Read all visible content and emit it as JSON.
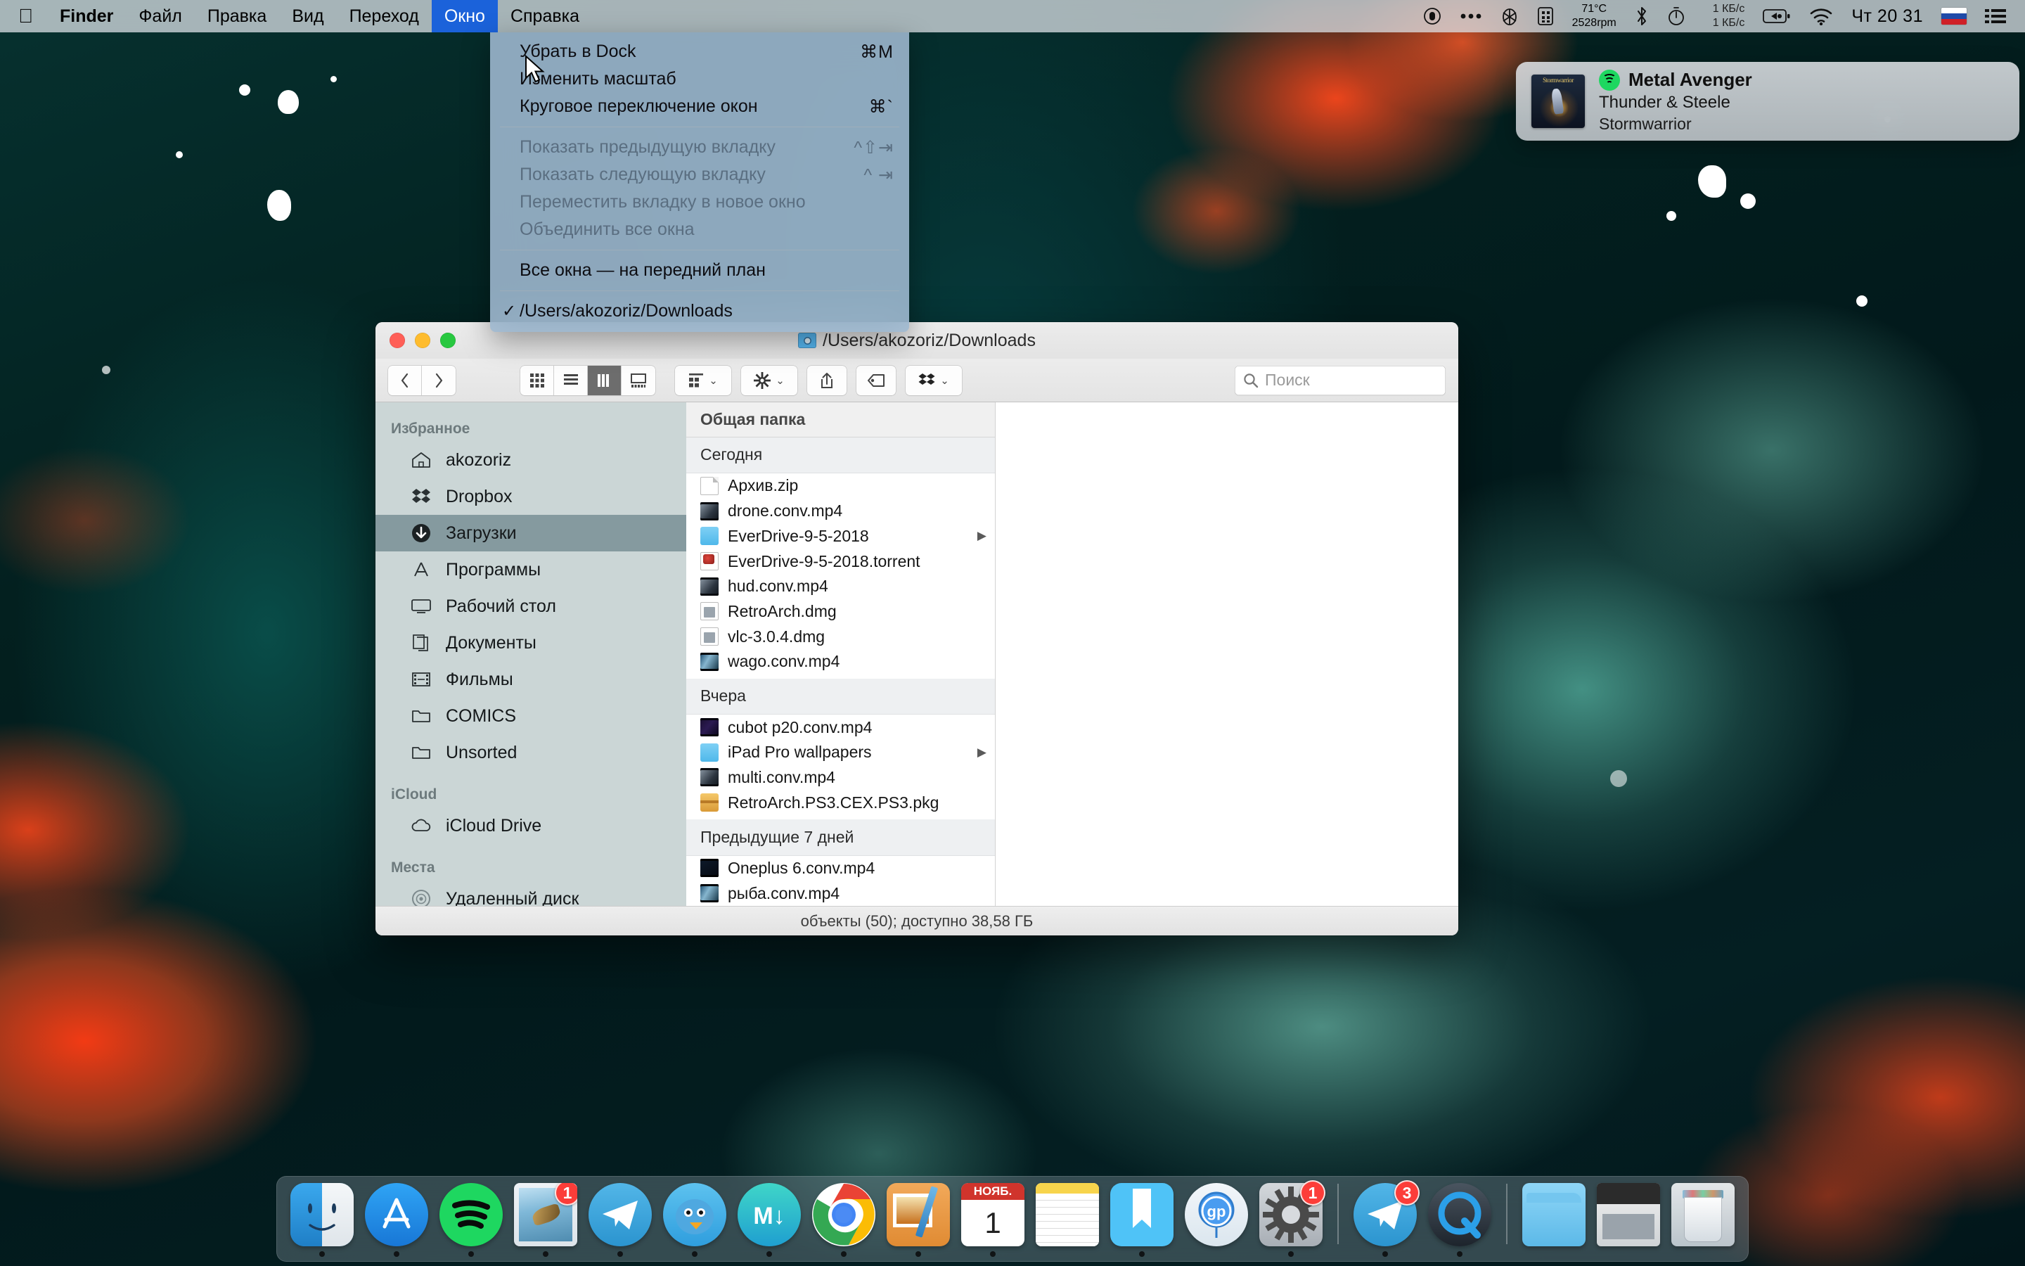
{
  "menubar": {
    "apple_icon": "apple-logo-icon",
    "items": [
      {
        "label": "Finder",
        "bold": true,
        "active": false
      },
      {
        "label": "Файл",
        "bold": false,
        "active": false
      },
      {
        "label": "Правка",
        "bold": false,
        "active": false
      },
      {
        "label": "Вид",
        "bold": false,
        "active": false
      },
      {
        "label": "Переход",
        "bold": false,
        "active": false
      },
      {
        "label": "Окно",
        "bold": false,
        "active": true
      },
      {
        "label": "Справка",
        "bold": false,
        "active": false
      }
    ],
    "status": {
      "record_icon": "record-circle-icon",
      "dots_icon": "three-dots-icon",
      "bartender_icon": "bartender-icon",
      "memory_icon": "memory-module-icon",
      "temperature": "71°C",
      "fan_rpm": "2528rpm",
      "bluetooth_icon": "bluetooth-icon",
      "timer_icon": "stopwatch-icon",
      "net_down": "1 КБ/с",
      "net_up": "1 КБ/с",
      "battery_icon": "battery-charging-icon",
      "wifi_icon": "wifi-icon",
      "clock": "Чт 20 31",
      "flag": "russian-flag-icon",
      "list_icon": "notification-center-icon"
    }
  },
  "window_menu": {
    "groups": [
      {
        "items": [
          {
            "label": "Убрать в Dock",
            "shortcut": "⌘M",
            "disabled": false,
            "checked": false
          },
          {
            "label": "Изменить масштаб",
            "shortcut": "",
            "disabled": false,
            "checked": false
          },
          {
            "label": "Круговое переключение окон",
            "shortcut": "⌘`",
            "disabled": false,
            "checked": false
          }
        ]
      },
      {
        "items": [
          {
            "label": "Показать предыдущую вкладку",
            "shortcut": "^⇧⇥",
            "disabled": true,
            "checked": false
          },
          {
            "label": "Показать следующую вкладку",
            "shortcut": "^ ⇥",
            "disabled": true,
            "checked": false
          },
          {
            "label": "Переместить вкладку в новое окно",
            "shortcut": "",
            "disabled": true,
            "checked": false
          },
          {
            "label": "Объединить все окна",
            "shortcut": "",
            "disabled": true,
            "checked": false
          }
        ]
      },
      {
        "items": [
          {
            "label": "Все окна — на передний план",
            "shortcut": "",
            "disabled": false,
            "checked": false
          }
        ]
      },
      {
        "items": [
          {
            "label": "/Users/akozoriz/Downloads",
            "shortcut": "",
            "disabled": false,
            "checked": true
          }
        ]
      }
    ],
    "check_glyph": "✓"
  },
  "notification": {
    "app": "Metal Avenger",
    "title": "Thunder & Steele",
    "subtitle": "Stormwarrior",
    "app_icon": "spotify-icon",
    "artwork_title": "Stormwarrior",
    "artwork_icon": "album-art-icon"
  },
  "finder": {
    "title_path": "/Users/akozoriz/Downloads",
    "proxy_icon": "folder-proxy-icon",
    "traffic": {
      "close": "close-button",
      "minimize": "minimize-button",
      "zoom": "zoom-button"
    },
    "nav": {
      "back": "back-button",
      "forward": "forward-button"
    },
    "view_modes": [
      {
        "name": "icon-view",
        "selected": false
      },
      {
        "name": "list-view",
        "selected": false
      },
      {
        "name": "column-view",
        "selected": true
      },
      {
        "name": "gallery-view",
        "selected": false
      }
    ],
    "toolbar_buttons": [
      {
        "name": "arrange-by-button",
        "icon": "grid-icon",
        "has_chevron": true
      },
      {
        "name": "action-button",
        "icon": "gear-icon",
        "has_chevron": true
      },
      {
        "name": "share-button",
        "icon": "share-icon",
        "has_chevron": false
      },
      {
        "name": "tags-button",
        "icon": "tag-icon",
        "has_chevron": false
      },
      {
        "name": "dropbox-button",
        "icon": "dropbox-icon",
        "has_chevron": true
      }
    ],
    "search_placeholder": "Поиск",
    "search_value": "",
    "sidebar": [
      {
        "header": "Избранное",
        "items": [
          {
            "label": "akozoriz",
            "icon": "home-icon",
            "selected": false
          },
          {
            "label": "Dropbox",
            "icon": "dropbox-icon",
            "selected": false
          },
          {
            "label": "Загрузки",
            "icon": "downloads-icon",
            "selected": true
          },
          {
            "label": "Программы",
            "icon": "applications-icon",
            "selected": false
          },
          {
            "label": "Рабочий стол",
            "icon": "desktop-icon",
            "selected": false
          },
          {
            "label": "Документы",
            "icon": "documents-icon",
            "selected": false
          },
          {
            "label": "Фильмы",
            "icon": "movies-icon",
            "selected": false
          },
          {
            "label": "COMICS",
            "icon": "folder-icon",
            "selected": false
          },
          {
            "label": "Unsorted",
            "icon": "folder-icon",
            "selected": false
          }
        ]
      },
      {
        "header": "iCloud",
        "items": [
          {
            "label": "iCloud Drive",
            "icon": "cloud-icon",
            "selected": false
          }
        ]
      },
      {
        "header": "Места",
        "items": [
          {
            "label": "Удаленный диск",
            "icon": "disc-icon",
            "selected": false
          }
        ]
      }
    ],
    "column_header": "Общая папка",
    "groups": [
      {
        "label": "Сегодня",
        "files": [
          {
            "name": "Архив.zip",
            "icon": "zip-icon",
            "kind": "doc",
            "has_arrow": false
          },
          {
            "name": "drone.conv.mp4",
            "icon": "video-icon",
            "kind": "video2",
            "has_arrow": false
          },
          {
            "name": "EverDrive-9-5-2018",
            "icon": "folder-icon",
            "kind": "folder",
            "has_arrow": true
          },
          {
            "name": "EverDrive-9-5-2018.torrent",
            "icon": "torrent-icon",
            "kind": "torrent",
            "has_arrow": false
          },
          {
            "name": "hud.conv.mp4",
            "icon": "video-icon",
            "kind": "video2",
            "has_arrow": false
          },
          {
            "name": "RetroArch.dmg",
            "icon": "disk-image-icon",
            "kind": "dmg",
            "has_arrow": false
          },
          {
            "name": "vlc-3.0.4.dmg",
            "icon": "disk-image-icon",
            "kind": "dmg",
            "has_arrow": false
          },
          {
            "name": "wago.conv.mp4",
            "icon": "video-icon",
            "kind": "video5",
            "has_arrow": false
          }
        ]
      },
      {
        "label": "Вчера",
        "files": [
          {
            "name": "cubot p20.conv.mp4",
            "icon": "video-icon",
            "kind": "video3",
            "has_arrow": false
          },
          {
            "name": "iPad Pro wallpapers",
            "icon": "folder-icon",
            "kind": "folder",
            "has_arrow": true
          },
          {
            "name": "multi.conv.mp4",
            "icon": "video-icon",
            "kind": "video2",
            "has_arrow": false
          },
          {
            "name": "RetroArch.PS3.CEX.PS3.pkg",
            "icon": "package-icon",
            "kind": "pkg",
            "has_arrow": false
          }
        ]
      },
      {
        "label": "Предыдущие 7 дней",
        "files": [
          {
            "name": "Oneplus 6.conv.mp4",
            "icon": "video-icon",
            "kind": "video4",
            "has_arrow": false
          },
          {
            "name": "рыба.conv.mp4",
            "icon": "video-icon",
            "kind": "video5",
            "has_arrow": false
          }
        ]
      }
    ],
    "status": "объекты (50); доступно 38,58 ГБ"
  },
  "dock": {
    "items": [
      {
        "name": "finder",
        "cls": "finder",
        "running": true,
        "badge": ""
      },
      {
        "name": "app-store",
        "cls": "appstore",
        "running": true,
        "badge": ""
      },
      {
        "name": "spotify",
        "cls": "spotify",
        "running": true,
        "badge": ""
      },
      {
        "name": "mail",
        "cls": "mail",
        "running": true,
        "badge": "1"
      },
      {
        "name": "telegram",
        "cls": "telegram",
        "running": true,
        "badge": ""
      },
      {
        "name": "tweetbot",
        "cls": "tweetbot",
        "running": true,
        "badge": ""
      },
      {
        "name": "marked",
        "cls": "marked",
        "running": true,
        "badge": ""
      },
      {
        "name": "google-chrome",
        "cls": "chrome",
        "running": true,
        "badge": ""
      },
      {
        "name": "preview",
        "cls": "preview",
        "running": true,
        "badge": ""
      },
      {
        "name": "calendar",
        "cls": "calendar",
        "running": true,
        "badge": ""
      },
      {
        "name": "notes",
        "cls": "notes",
        "running": false,
        "badge": ""
      },
      {
        "name": "bookmark-app",
        "cls": "bookmark",
        "running": true,
        "badge": ""
      },
      {
        "name": "gpgtools",
        "cls": "gp",
        "running": false,
        "badge": ""
      },
      {
        "name": "system-preferences",
        "cls": "sysprefs",
        "running": true,
        "badge": "1"
      },
      {
        "name": "telegram-desktop",
        "cls": "telegram",
        "running": true,
        "badge": "3"
      },
      {
        "name": "quicktime",
        "cls": "quicktime",
        "running": true,
        "badge": ""
      },
      {
        "name": "downloads-folder",
        "cls": "dlfolder",
        "running": false,
        "badge": ""
      },
      {
        "name": "documents-stack",
        "cls": "docfolder",
        "running": false,
        "badge": ""
      },
      {
        "name": "trash",
        "cls": "trash",
        "running": false,
        "badge": ""
      }
    ],
    "calendar_month": "НОЯБ.",
    "calendar_day": "1"
  }
}
